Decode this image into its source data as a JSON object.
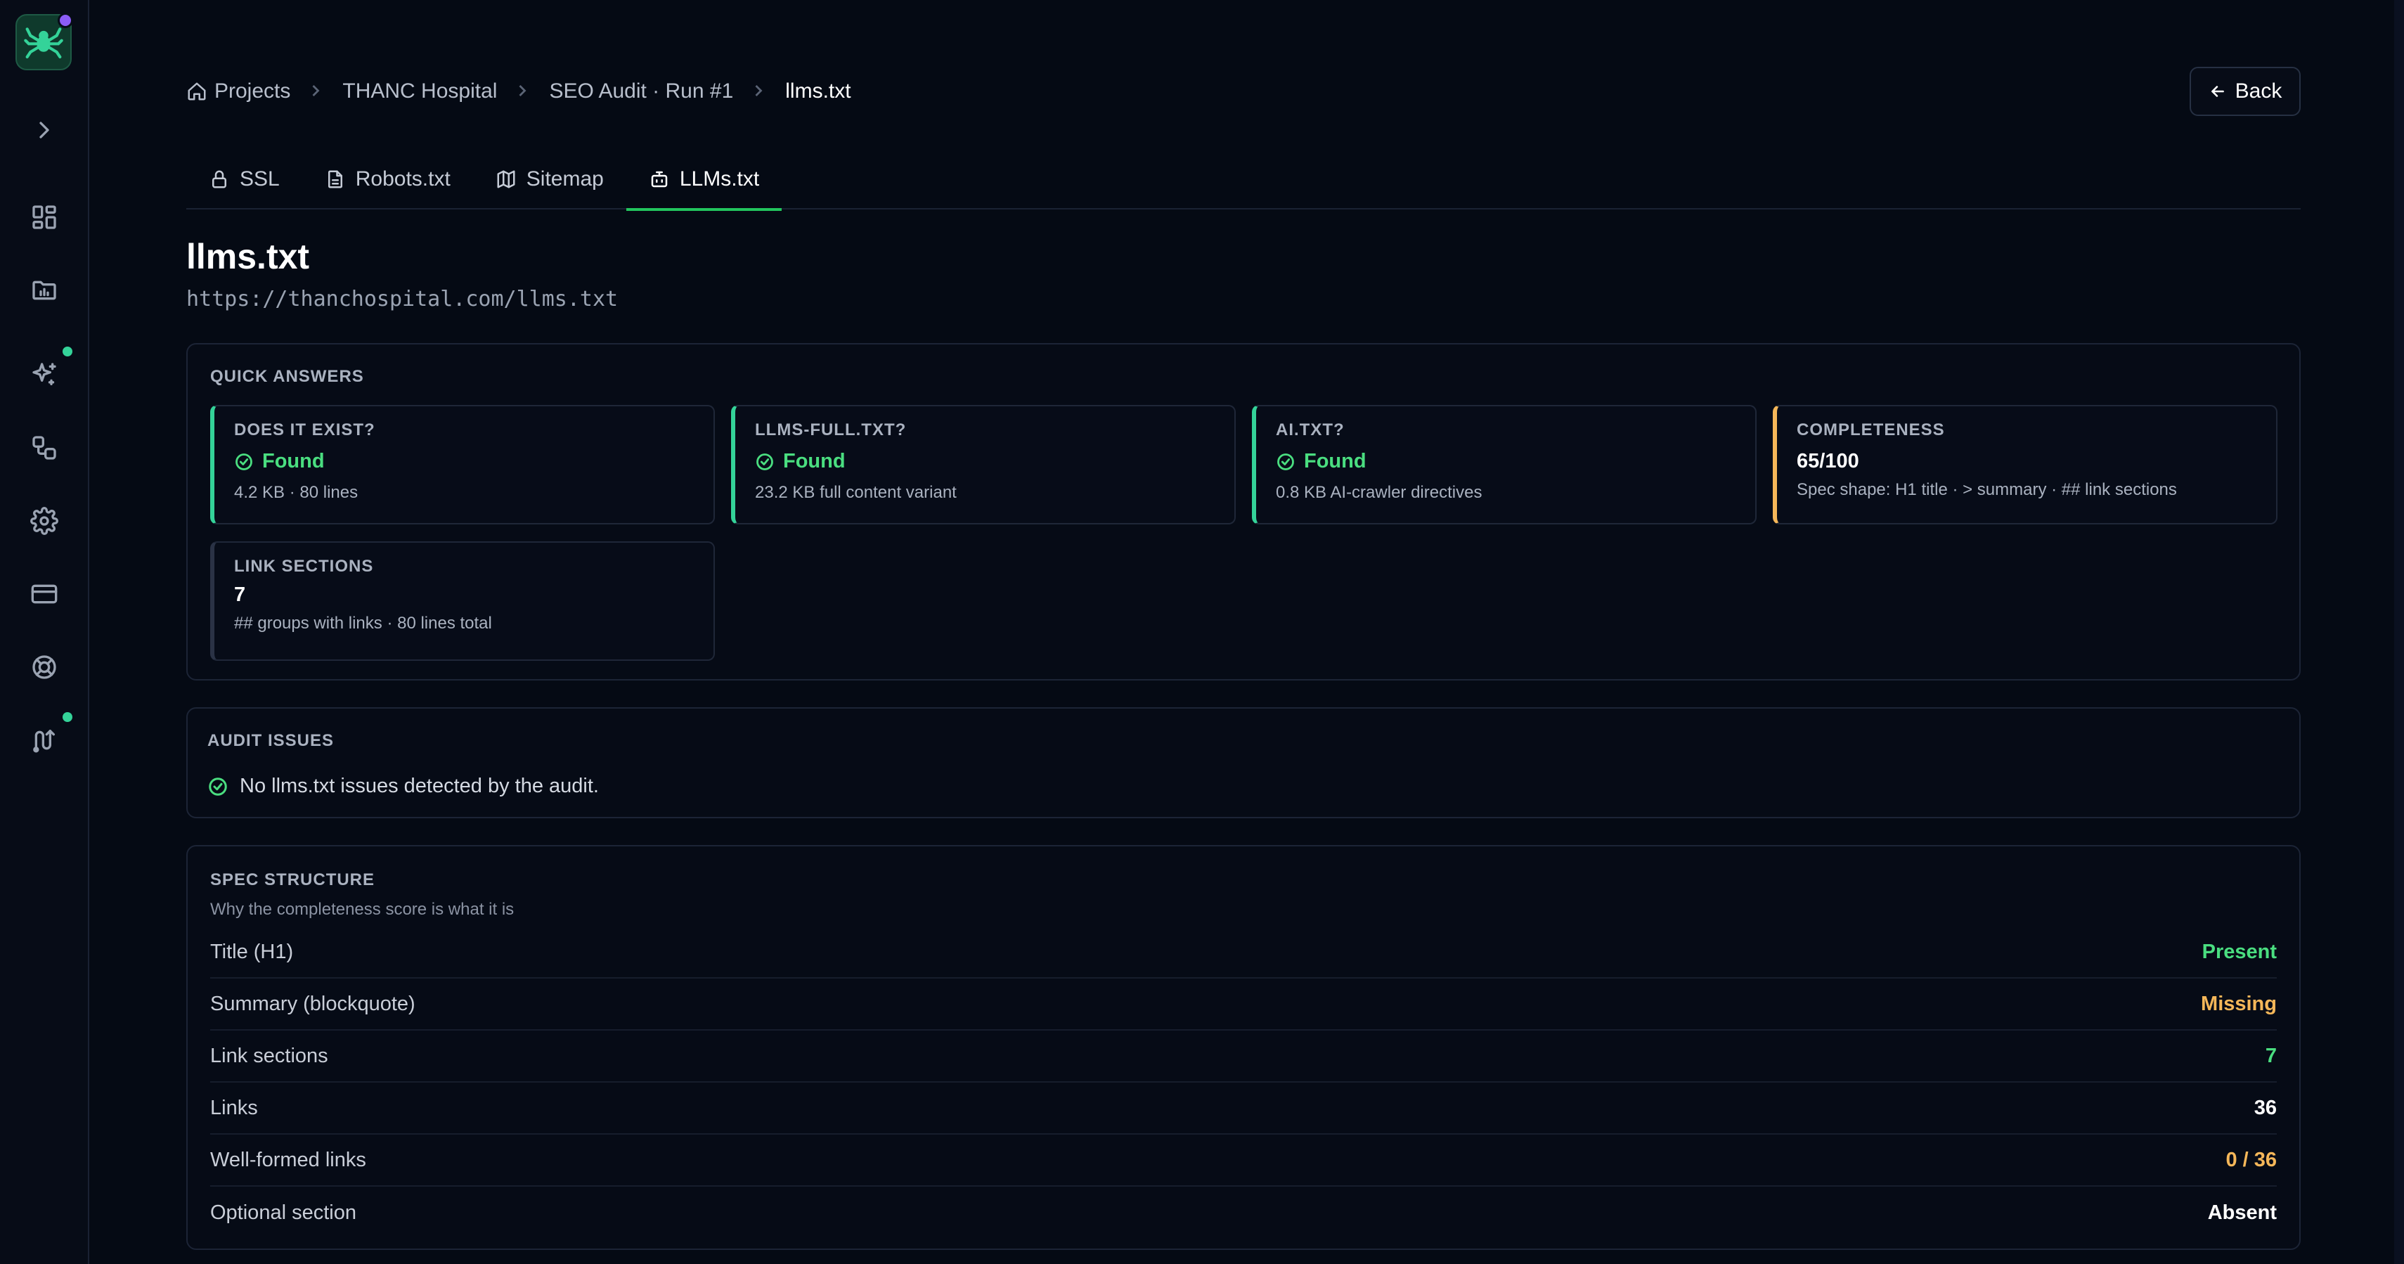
{
  "breadcrumb": {
    "items": [
      "Projects",
      "THANC Hospital",
      "SEO Audit · Run #1",
      "llms.txt"
    ]
  },
  "back_label": "Back",
  "tabs": [
    {
      "label": "SSL",
      "icon": "lock-icon"
    },
    {
      "label": "Robots.txt",
      "icon": "file-icon"
    },
    {
      "label": "Sitemap",
      "icon": "map-icon"
    },
    {
      "label": "LLMs.txt",
      "icon": "bot-icon",
      "active": true
    }
  ],
  "page": {
    "title": "llms.txt",
    "url": "https://thanchospital.com/llms.txt"
  },
  "quick_answers": {
    "label": "QUICK ANSWERS",
    "cards": [
      {
        "label": "DOES IT EXIST?",
        "value": "Found",
        "sub": "4.2 KB · 80 lines"
      },
      {
        "label": "LLMS-FULL.TXT?",
        "value": "Found",
        "sub": "23.2 KB full content variant"
      },
      {
        "label": "AI.TXT?",
        "value": "Found",
        "sub": "0.8 KB AI-crawler directives"
      },
      {
        "label": "COMPLETENESS",
        "value": "65/100",
        "sub": "Spec shape: H1 title · > summary · ## link sections"
      },
      {
        "label": "LINK SECTIONS",
        "value": "7",
        "sub": "## groups with links · 80 lines total"
      }
    ]
  },
  "audit_issues": {
    "label": "AUDIT ISSUES",
    "message": "No llms.txt issues detected by the audit."
  },
  "spec_structure": {
    "label": "SPEC STRUCTURE",
    "subtitle": "Why the completeness score is what it is",
    "rows": [
      {
        "label": "Title (H1)",
        "value": "Present"
      },
      {
        "label": "Summary (blockquote)",
        "value": "Missing"
      },
      {
        "label": "Link sections",
        "value": "7"
      },
      {
        "label": "Links",
        "value": "36"
      },
      {
        "label": "Well-formed links",
        "value": "0 / 36"
      },
      {
        "label": "Optional section",
        "value": "Absent"
      }
    ]
  },
  "colors": {
    "background": "#050a14",
    "accent_green": "#22c55e",
    "status_green": "#4ade80",
    "status_amber": "#f5b759",
    "notification_purple": "#8b5cf6"
  }
}
